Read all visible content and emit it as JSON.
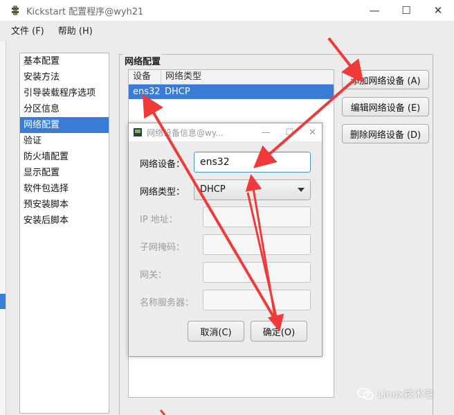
{
  "window": {
    "title": "Kickstart 配置程序@wyh21",
    "minimize": "—",
    "maximize": "☐",
    "close": "✕"
  },
  "menu": {
    "file": "文件 (F)",
    "help": "帮助 (H)"
  },
  "sidebar": {
    "items": [
      {
        "label": "基本配置"
      },
      {
        "label": "安装方法"
      },
      {
        "label": "引导装载程序选项"
      },
      {
        "label": "分区信息"
      },
      {
        "label": "网络配置",
        "selected": true
      },
      {
        "label": "验证"
      },
      {
        "label": "防火墙配置"
      },
      {
        "label": "显示配置"
      },
      {
        "label": "软件包选择"
      },
      {
        "label": "预安装脚本"
      },
      {
        "label": "安装后脚本"
      }
    ]
  },
  "network": {
    "group_title": "网络配置",
    "table": {
      "headers": [
        "设备",
        "网络类型"
      ],
      "rows": [
        [
          "ens32",
          "DHCP"
        ]
      ]
    },
    "buttons": {
      "add": "添加网络设备 (A)",
      "edit": "编辑网络设备 (E)",
      "delete": "删除网络设备 (D)"
    }
  },
  "dialog": {
    "title": "网络设备信息@wy...",
    "device_label": "网络设备：",
    "device_value": "ens32",
    "type_label": "网络类型：",
    "type_value": "DHCP",
    "ip_label": "IP 地址：",
    "mask_label": "子网掩码：",
    "gateway_label": "网关：",
    "dns_label": "名称服务器：",
    "cancel": "取消(C)",
    "ok": "确定(O)"
  },
  "watermark": {
    "text": "Linux技术宅"
  },
  "colors": {
    "selection": "#3a7bd5",
    "annotation_arrow": "#f03a3a"
  }
}
